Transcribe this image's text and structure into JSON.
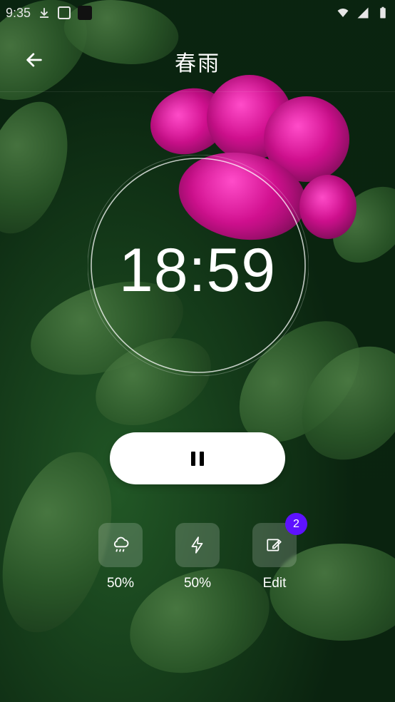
{
  "status_bar": {
    "time": "9:35"
  },
  "header": {
    "title": "春雨"
  },
  "timer": {
    "time": "18:59"
  },
  "controls": [
    {
      "icon": "rain-cloud-icon",
      "label": "50%"
    },
    {
      "icon": "lightning-icon",
      "label": "50%"
    },
    {
      "icon": "edit-icon",
      "label": "Edit"
    }
  ],
  "edit_badge": "2",
  "colors": {
    "badge": "#5e12ff",
    "button_bg": "#ffffff"
  }
}
